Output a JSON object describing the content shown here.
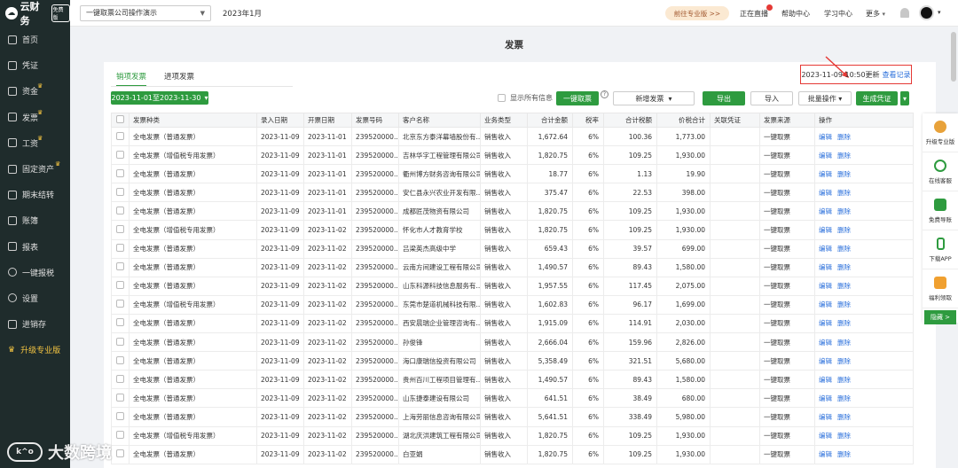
{
  "sidebar": {
    "logo": "云财务",
    "badge": "免费版",
    "items": [
      {
        "label": "首页"
      },
      {
        "label": "凭证"
      },
      {
        "label": "资金"
      },
      {
        "label": "发票"
      },
      {
        "label": "工资"
      },
      {
        "label": "固定资产"
      },
      {
        "label": "期末结转"
      },
      {
        "label": "账簿"
      },
      {
        "label": "报表"
      },
      {
        "label": "一键报税"
      },
      {
        "label": "设置"
      },
      {
        "label": "进销存"
      },
      {
        "label": "升级专业版"
      }
    ]
  },
  "topbar": {
    "company": "一键取票公司操作演示",
    "period": "2023年1月",
    "pro": "前往专业版 >>",
    "live": "正在直播",
    "help": "帮助中心",
    "learn": "学习中心",
    "more": "更多"
  },
  "page": {
    "title": "发票",
    "tab_sales": "销项发票",
    "tab_purchase": "进项发票",
    "update_time": "2023-11-09 10:50更新",
    "view_log": "查看记录",
    "date_range": "2023-11-01至2023-11-30",
    "show_all": "显示所有信息",
    "btn_fetch": "一键取票",
    "btn_new": "新增发票",
    "btn_export": "导出",
    "btn_import": "导入",
    "btn_batch": "批量操作",
    "btn_voucher": "生成凭证"
  },
  "table": {
    "headers": [
      "发票种类",
      "录入日期",
      "开票日期",
      "发票号码",
      "客户名称",
      "业务类型",
      "合计金额",
      "税率",
      "合计税额",
      "价税合计",
      "关联凭证",
      "发票来源",
      "操作"
    ],
    "edit": "编辑",
    "delete": "删除",
    "rows": [
      [
        "全电发票（普通发票）",
        "2023-11-09",
        "2023-11-01",
        "239520000...",
        "北京东方泰洋幕墙股份有...",
        "销售收入",
        "1,672.64",
        "6%",
        "100.36",
        "1,773.00",
        "",
        "一键取票"
      ],
      [
        "全电发票（增值税专用发票）",
        "2023-11-09",
        "2023-11-01",
        "239520000...",
        "吉林华字工程管理有限公司",
        "销售收入",
        "1,820.75",
        "6%",
        "109.25",
        "1,930.00",
        "",
        "一键取票"
      ],
      [
        "全电发票（普通发票）",
        "2023-11-09",
        "2023-11-01",
        "239520000...",
        "衢州博方财务咨询有限公司",
        "销售收入",
        "18.77",
        "6%",
        "1.13",
        "19.90",
        "",
        "一键取票"
      ],
      [
        "全电发票（普通发票）",
        "2023-11-09",
        "2023-11-01",
        "239520000...",
        "安仁县永兴农业开发有限...",
        "销售收入",
        "375.47",
        "6%",
        "22.53",
        "398.00",
        "",
        "一键取票"
      ],
      [
        "全电发票（普通发票）",
        "2023-11-09",
        "2023-11-01",
        "239520000...",
        "成都匠茂物资有限公司",
        "销售收入",
        "1,820.75",
        "6%",
        "109.25",
        "1,930.00",
        "",
        "一键取票"
      ],
      [
        "全电发票（增值税专用发票）",
        "2023-11-09",
        "2023-11-02",
        "239520000...",
        "怀化市人才教育学校",
        "销售收入",
        "1,820.75",
        "6%",
        "109.25",
        "1,930.00",
        "",
        "一键取票"
      ],
      [
        "全电发票（普通发票）",
        "2023-11-09",
        "2023-11-02",
        "239520000...",
        "吕梁英杰高级中学",
        "销售收入",
        "659.43",
        "6%",
        "39.57",
        "699.00",
        "",
        "一键取票"
      ],
      [
        "全电发票（普通发票）",
        "2023-11-09",
        "2023-11-02",
        "239520000...",
        "云南方间建设工程有限公司",
        "销售收入",
        "1,490.57",
        "6%",
        "89.43",
        "1,580.00",
        "",
        "一键取票"
      ],
      [
        "全电发票（普通发票）",
        "2023-11-09",
        "2023-11-02",
        "239520000...",
        "山东科源科技信息服务有...",
        "销售收入",
        "1,957.55",
        "6%",
        "117.45",
        "2,075.00",
        "",
        "一键取票"
      ],
      [
        "全电发票（增值税专用发票）",
        "2023-11-09",
        "2023-11-02",
        "239520000...",
        "东莞市楚道机械科技有限...",
        "销售收入",
        "1,602.83",
        "6%",
        "96.17",
        "1,699.00",
        "",
        "一键取票"
      ],
      [
        "全电发票（普通发票）",
        "2023-11-09",
        "2023-11-02",
        "239520000...",
        "西安晨瑞企业管理咨询有...",
        "销售收入",
        "1,915.09",
        "6%",
        "114.91",
        "2,030.00",
        "",
        "一键取票"
      ],
      [
        "全电发票（普通发票）",
        "2023-11-09",
        "2023-11-02",
        "239520000...",
        "孙俊锋",
        "销售收入",
        "2,666.04",
        "6%",
        "159.96",
        "2,826.00",
        "",
        "一键取票"
      ],
      [
        "全电发票（普通发票）",
        "2023-11-09",
        "2023-11-02",
        "239520000...",
        "海口康瑞信投资有限公司",
        "销售收入",
        "5,358.49",
        "6%",
        "321.51",
        "5,680.00",
        "",
        "一键取票"
      ],
      [
        "全电发票（普通发票）",
        "2023-11-09",
        "2023-11-02",
        "239520000...",
        "贵州百川工程项目管理有...",
        "销售收入",
        "1,490.57",
        "6%",
        "89.43",
        "1,580.00",
        "",
        "一键取票"
      ],
      [
        "全电发票（普通发票）",
        "2023-11-09",
        "2023-11-02",
        "239520000...",
        "山东捷泰建设有限公司",
        "销售收入",
        "641.51",
        "6%",
        "38.49",
        "680.00",
        "",
        "一键取票"
      ],
      [
        "全电发票（普通发票）",
        "2023-11-09",
        "2023-11-02",
        "239520000...",
        "上海劳丽信息咨询有限公司",
        "销售收入",
        "5,641.51",
        "6%",
        "338.49",
        "5,980.00",
        "",
        "一键取票"
      ],
      [
        "全电发票（增值税专用发票）",
        "2023-11-09",
        "2023-11-02",
        "239520000...",
        "湖北庆洪建筑工程有限公司",
        "销售收入",
        "1,820.75",
        "6%",
        "109.25",
        "1,930.00",
        "",
        "一键取票"
      ],
      [
        "全电发票（普通发票）",
        "2023-11-09",
        "2023-11-02",
        "239520000...",
        "白亚娟",
        "销售收入",
        "1,820.75",
        "6%",
        "109.25",
        "1,930.00",
        "",
        "一键取票"
      ]
    ]
  },
  "rightbar": {
    "items": [
      "升级专业版",
      "在线客服",
      "免费导账",
      "下载APP",
      "福利领取"
    ],
    "hide": "隐藏 >"
  },
  "watermark": {
    "text": "大数跨境",
    "mark": "k^o"
  },
  "colors": {
    "accent": "#2e9b3f",
    "sidebar": "#1f2c2c",
    "link": "#2a6fdb",
    "alert": "#e53935"
  }
}
